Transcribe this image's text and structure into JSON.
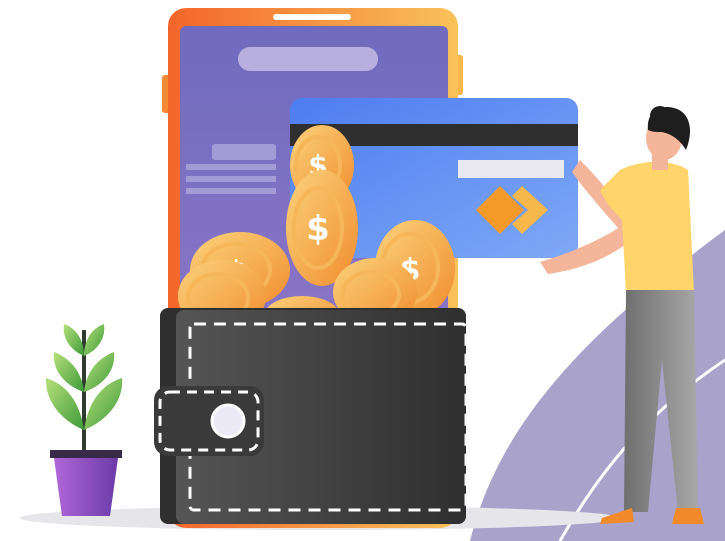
{
  "illustration": {
    "subject": "digital-wallet-payment",
    "colors": {
      "phone_frame": "#F97A2B",
      "phone_frame_light": "#F9C25A",
      "phone_screen": "#7D74C4",
      "card_blue": "#5D8CF0",
      "card_stripe": "#2F2F2F",
      "card_logo": "#F39A2A",
      "coin": "#F7A548",
      "coin_symbol": "#FFFFFF",
      "wallet": "#3E3E3E",
      "wallet_stitch": "#FFFFFF",
      "plant_leaf": "#7CC04A",
      "pot": "#8E4CC0",
      "shirt": "#FFD46B",
      "trousers": "#8A8A8A",
      "hair": "#1E1E1E",
      "skin": "#F4B59A",
      "shoes": "#F08A2A",
      "backdrop": "#A9A3CB"
    },
    "icons": [
      "smartphone-icon",
      "credit-card-icon",
      "coin-icon",
      "wallet-icon",
      "plant-icon",
      "person-icon"
    ]
  }
}
